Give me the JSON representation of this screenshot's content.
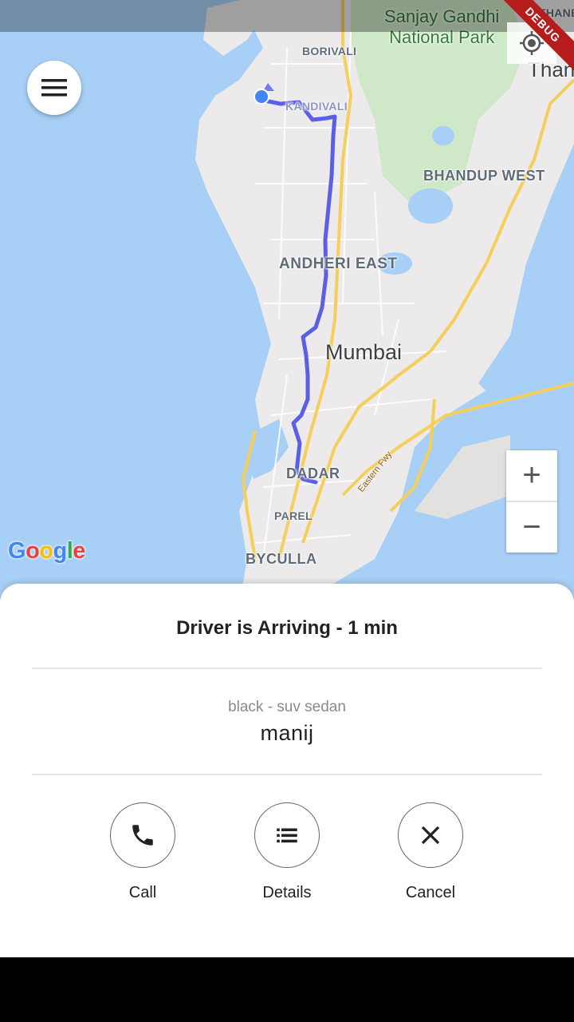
{
  "map": {
    "labels": {
      "park": "Sanjay Gandhi\nNational Park",
      "thane_west": "THANE WE",
      "thane": "Than",
      "borivali": "BORIVALI",
      "kandivali": "KANDIVALI",
      "bhandup_west": "BHANDUP WEST",
      "andheri_east": "ANDHERI EAST",
      "mumbai": "Mumbai",
      "dadar": "DADAR",
      "parel": "PAREL",
      "byculla": "BYCULLA",
      "eastern_fwy": "Eastern Fwy"
    },
    "google_logo": [
      "G",
      "o",
      "o",
      "g",
      "l",
      "e"
    ],
    "google_colors": [
      "#4285F4",
      "#EA4335",
      "#FBBC05",
      "#4285F4",
      "#34A853",
      "#EA4335"
    ],
    "route_color": "#5a5fe6",
    "zoom_in": "+",
    "zoom_out": "−",
    "debug_banner": "DEBUG"
  },
  "sheet": {
    "status_title": "Driver is Arriving - 1 min",
    "vehicle": "black - suv sedan",
    "driver_name": "manij",
    "actions": [
      {
        "label": "Call",
        "icon": "phone-icon"
      },
      {
        "label": "Details",
        "icon": "list-icon"
      },
      {
        "label": "Cancel",
        "icon": "close-icon"
      }
    ]
  }
}
